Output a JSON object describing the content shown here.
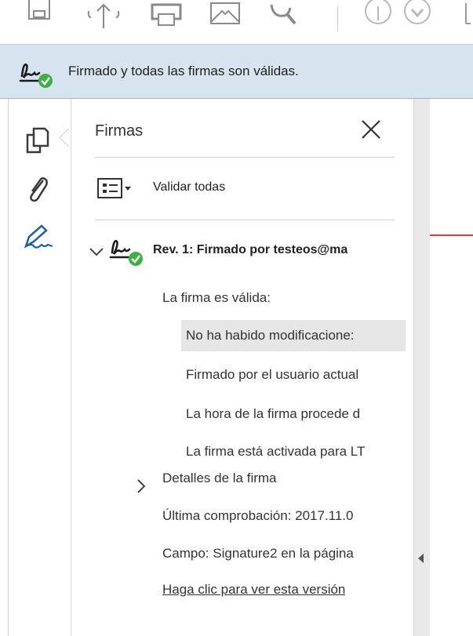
{
  "toolbar": {
    "icons": [
      "save-icon",
      "cloud-upload-icon",
      "print-icon",
      "email-icon",
      "search-icon",
      "up-arrow-icon",
      "down-arrow-icon"
    ]
  },
  "signature_bar": {
    "message": "Firmado y todas las firmas son válidas.",
    "icon": "signature-valid-icon"
  },
  "left_rail": {
    "icons": [
      "pages-icon",
      "attachment-icon",
      "signature-pen-icon"
    ]
  },
  "panel": {
    "title": "Firmas",
    "validate_all_label": "Validar todas",
    "revision": {
      "label": "Rev. 1: Firmado por testeos@ma",
      "status": "La firma es válida:",
      "details": [
        "No ha habido modificacione:",
        "Firmado por el usuario actual",
        "La hora de la firma procede d",
        "La firma está activada para LT"
      ],
      "signature_details_label": "Detalles de la firma",
      "last_checked": "Última comprobación: 2017.11.0",
      "field": "Campo: Signature2 en la página",
      "view_version_link": "Haga clic para ver esta versión"
    }
  },
  "colors": {
    "sigbar_bg": "#d7e4ef",
    "valid_green": "#3cb043",
    "doc_red_line": "#e33333"
  }
}
